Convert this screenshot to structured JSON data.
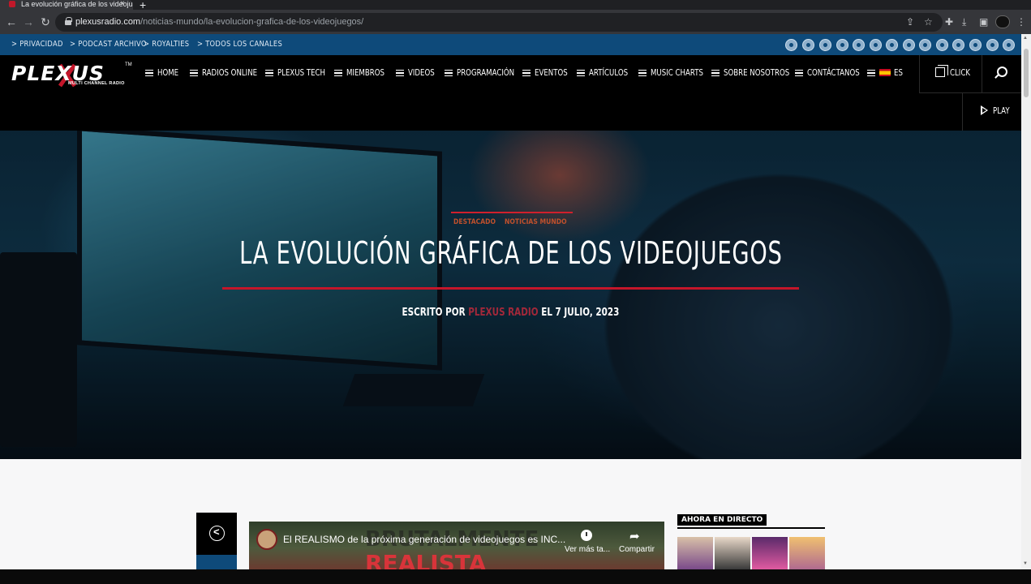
{
  "browser": {
    "tab_title": "La evolución gráfica de los videojuegos",
    "tab_close": "×",
    "new_tab": "+",
    "url_domain": "plexusradio.com",
    "url_path": "/noticias-mundo/la-evolucion-grafica-de-los-videojuegos/"
  },
  "topbar": {
    "links": [
      "> PRIVACIDAD",
      "> PODCAST ARCHIVO",
      "> ROYALTIES",
      "> TODOS LOS CANALES"
    ]
  },
  "logo": {
    "text": "PLEXUS",
    "tm": "TM",
    "subtitle": "MULTI CHANNEL RADIO"
  },
  "nav": {
    "items": [
      "HOME",
      "RADIOS ONLINE",
      "PLEXUS TECH",
      "MIEMBROS",
      "VIDEOS",
      "PROGRAMACIÓN",
      "EVENTOS",
      "ARTÍCULOS",
      "MUSIC CHARTS",
      "SOBRE NOSOTROS",
      "CONTÁCTANOS"
    ],
    "language": "ES",
    "click_label": "CLICK",
    "play_label": "PLAY"
  },
  "hero": {
    "categories": [
      "DESTACADO",
      "NOTICIAS MUNDO"
    ],
    "title": "LA EVOLUCIÓN GRÁFICA DE LOS VIDEOJUEGOS",
    "byline_prefix": "ESCRITO POR",
    "author": "PLEXUS RADIO",
    "byline_suffix": "EL 7 JULIO, 2023",
    "accent_color": "#c4162a"
  },
  "video": {
    "title": "El REALISMO de la próxima generación de videojuegos es INC...",
    "watch_later": "Ver más ta...",
    "share": "Compartir",
    "overlay_line1": "BRUTALMENTE",
    "overlay_line2": "REALISTA"
  },
  "sidebar": {
    "live_label": "AHORA EN DIRECTO"
  },
  "colors": {
    "topbar_blue": "#0e4a7a",
    "nav_black": "#000000"
  }
}
